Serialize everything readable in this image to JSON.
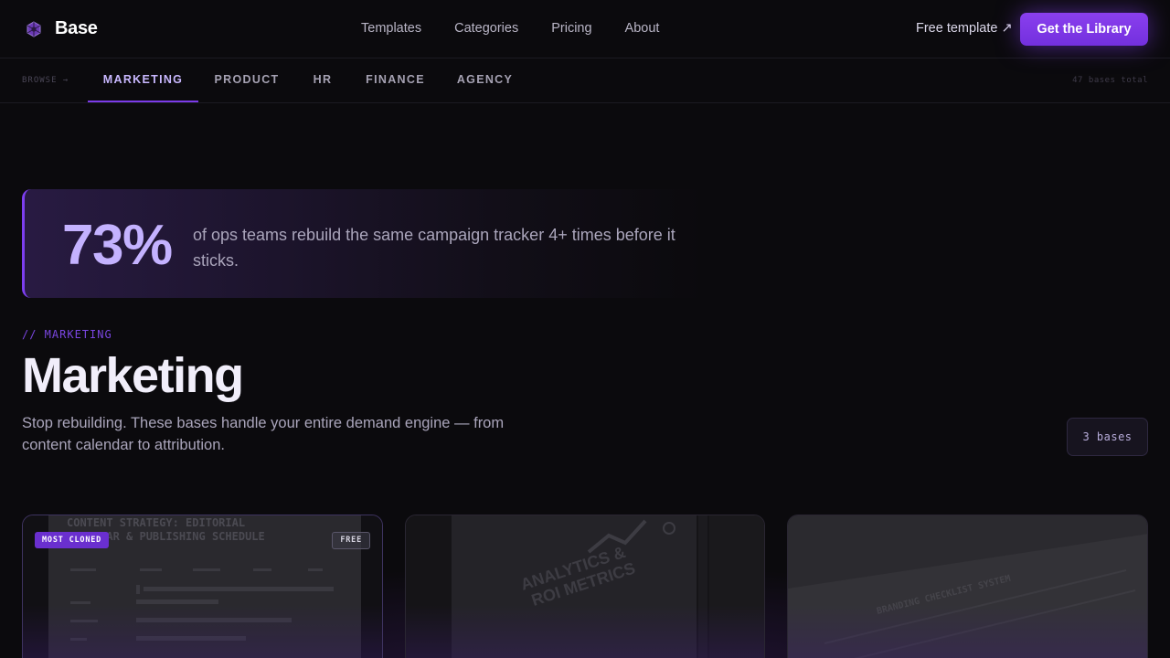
{
  "header": {
    "brand": "Base",
    "nav": [
      "Templates",
      "Categories",
      "Pricing",
      "About"
    ],
    "free_link": "Free template ↗",
    "cta": "Get the Library"
  },
  "categories": {
    "browse_label": "BROWSE →",
    "tabs": [
      "MARKETING",
      "PRODUCT",
      "HR",
      "FINANCE",
      "AGENCY"
    ],
    "active": "MARKETING",
    "total": "47 bases total"
  },
  "stat": {
    "value": "73%",
    "text": "of ops teams rebuild the same campaign tracker 4+ times before it sticks."
  },
  "section": {
    "eyebrow": "// MARKETING",
    "title": "Marketing",
    "description": "Stop rebuilding. These bases handle your entire demand engine — from content calendar to attribution.",
    "count": "3 bases"
  },
  "cards": [
    {
      "badge": "MOST CLONED",
      "tag": "FREE",
      "image_text": [
        "CONTENT STRATEGY: EDITORIAL",
        "CALENDAR & PUBLISHING SCHEDULE"
      ]
    },
    {
      "image_text": [
        "ANALYTICS &",
        "ROI METRICS"
      ]
    },
    {
      "image_text": [
        "BRANDING CHECKLIST SYSTEM"
      ]
    }
  ],
  "colors": {
    "accent": "#7b3ae8",
    "accent_light": "#c4b2ff",
    "background": "#0b0a0d"
  }
}
